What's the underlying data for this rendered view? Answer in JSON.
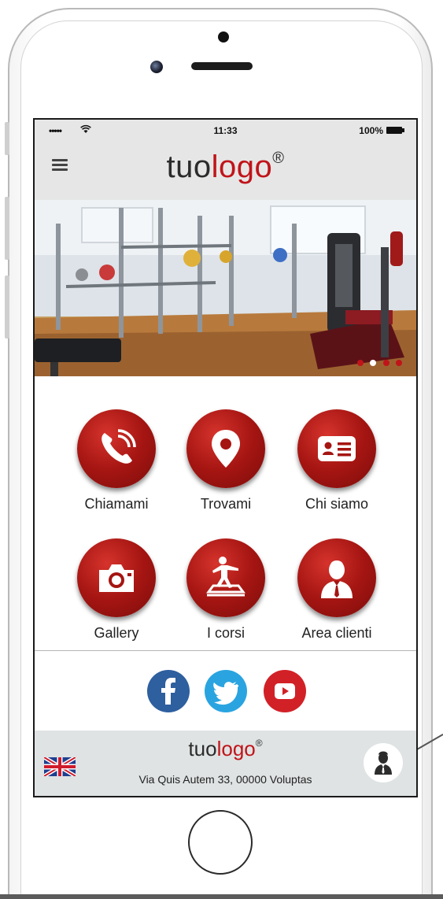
{
  "status_bar": {
    "signal": "••••• ",
    "time": "11:33",
    "battery": "100%"
  },
  "header": {
    "logo_prefix": "tuo",
    "logo_suffix": "logo",
    "logo_mark": "®"
  },
  "hero": {
    "slider_dots": [
      "#c0141a",
      "#ffffff",
      "#c0141a",
      "#c0141a"
    ]
  },
  "menu": {
    "items": [
      {
        "label": "Chiamami",
        "icon": "phone-icon"
      },
      {
        "label": "Trovami",
        "icon": "map-pin-icon"
      },
      {
        "label": "Chi siamo",
        "icon": "id-card-icon"
      },
      {
        "label": "Gallery",
        "icon": "camera-icon"
      },
      {
        "label": "I corsi",
        "icon": "fitness-icon"
      },
      {
        "label": "Area clienti",
        "icon": "user-icon"
      }
    ]
  },
  "social": {
    "items": [
      {
        "name": "facebook-icon",
        "color": "#2e5f9f"
      },
      {
        "name": "twitter-icon",
        "color": "#2aa4e0"
      },
      {
        "name": "youtube-icon",
        "color": "#d12127"
      }
    ]
  },
  "footer": {
    "logo_prefix": "tuo",
    "logo_suffix": "logo",
    "logo_mark": "®",
    "address": "Via Quis Autem 33, 00000 Voluptas",
    "language_flag": "uk-flag-icon",
    "user_button": "user-icon"
  },
  "colors": {
    "accent": "#c0141a",
    "header_bg": "#e6e6e6",
    "footer_bg": "#dfe3e3"
  }
}
